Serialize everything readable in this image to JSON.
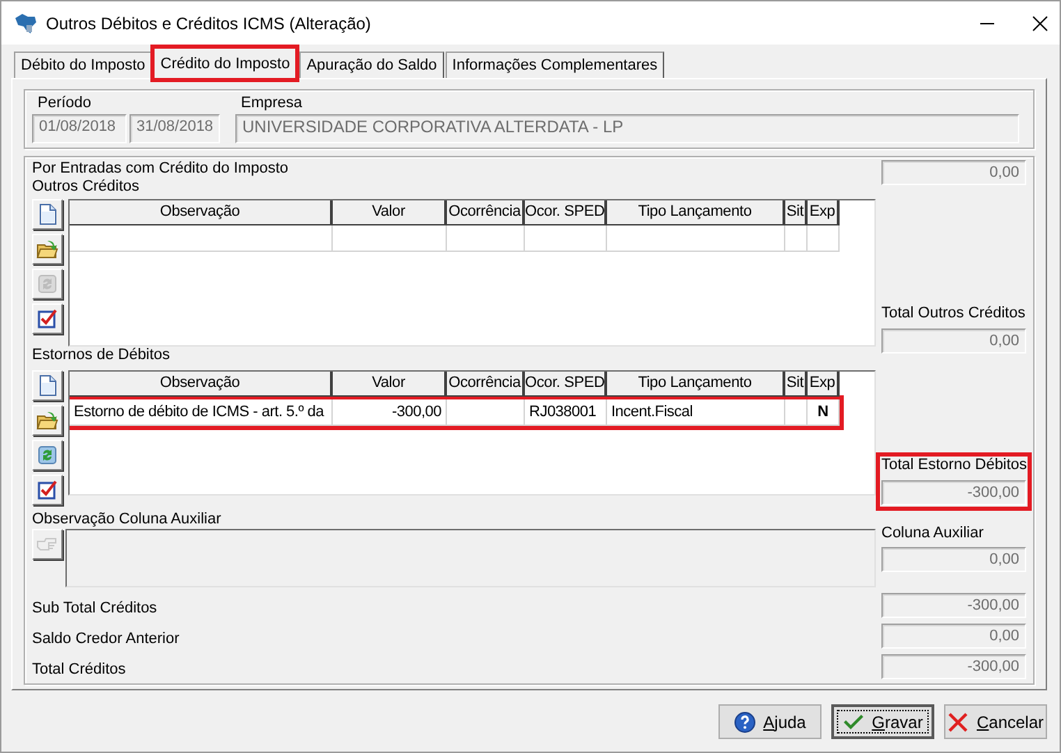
{
  "window": {
    "title": "Outros Débitos e Créditos ICMS (Alteração)"
  },
  "tabs": [
    {
      "label": "Débito do Imposto",
      "selected": false,
      "highlighted": false
    },
    {
      "label": "Crédito do Imposto",
      "selected": true,
      "highlighted": true
    },
    {
      "label": "Apuração do Saldo",
      "selected": false,
      "highlighted": false
    },
    {
      "label": "Informações Complementares",
      "selected": false,
      "highlighted": false
    }
  ],
  "period": {
    "period_label": "Período",
    "start": "01/08/2018",
    "end": "31/08/2018",
    "company_label": "Empresa",
    "company": "UNIVERSIDADE CORPORATIVA ALTERDATA - LP"
  },
  "section_title": "Por Entradas com Crédito do Imposto",
  "section_total": "0,00",
  "grids": [
    {
      "title": "Outros Créditos",
      "columns": [
        "Observação",
        "Valor",
        "Ocorrência",
        "Ocor. SPED",
        "Tipo Lançamento",
        "Sit",
        "Exp"
      ],
      "toolbar": [
        {
          "kind": "new",
          "disabled": false
        },
        {
          "kind": "open",
          "disabled": false
        },
        {
          "kind": "refresh",
          "disabled": true
        },
        {
          "kind": "check",
          "disabled": false
        }
      ],
      "rows": [
        {
          "highlighted": false
        }
      ],
      "total": {
        "label": "Total Outros Créditos",
        "value": "0,00",
        "highlighted": false
      }
    },
    {
      "title": "Estornos de Débitos",
      "columns": [
        "Observação",
        "Valor",
        "Ocorrência",
        "Ocor. SPED",
        "Tipo Lançamento",
        "Sit",
        "Exp"
      ],
      "toolbar": [
        {
          "kind": "new",
          "disabled": false
        },
        {
          "kind": "open",
          "disabled": false
        },
        {
          "kind": "refresh",
          "disabled": false
        },
        {
          "kind": "check",
          "disabled": false
        }
      ],
      "rows": [
        {
          "highlighted": true,
          "cells": [
            "Estorno de débito de ICMS - art. 5.º da",
            "-300,00",
            null,
            "RJ038001",
            "Incent.Fiscal",
            null,
            "N"
          ]
        }
      ],
      "total": {
        "label": "Total Estorno Débitos",
        "value": "-300,00",
        "highlighted": true
      }
    }
  ],
  "aux": {
    "title": "Observação Coluna Auxiliar",
    "button_disabled": true,
    "total_label": "Coluna Auxiliar",
    "total_value": "0,00"
  },
  "summary": [
    {
      "label": "Sub Total Créditos",
      "value": "-300,00"
    },
    {
      "label": "Saldo Credor Anterior",
      "value": "0,00"
    },
    {
      "label": "Total Créditos",
      "value": "-300,00"
    }
  ],
  "buttons": [
    {
      "label": "Ajuda",
      "kind": "help",
      "default": false
    },
    {
      "label": "Gravar",
      "kind": "save",
      "default": true
    },
    {
      "label": "Cancelar",
      "kind": "cancel",
      "default": false
    }
  ]
}
